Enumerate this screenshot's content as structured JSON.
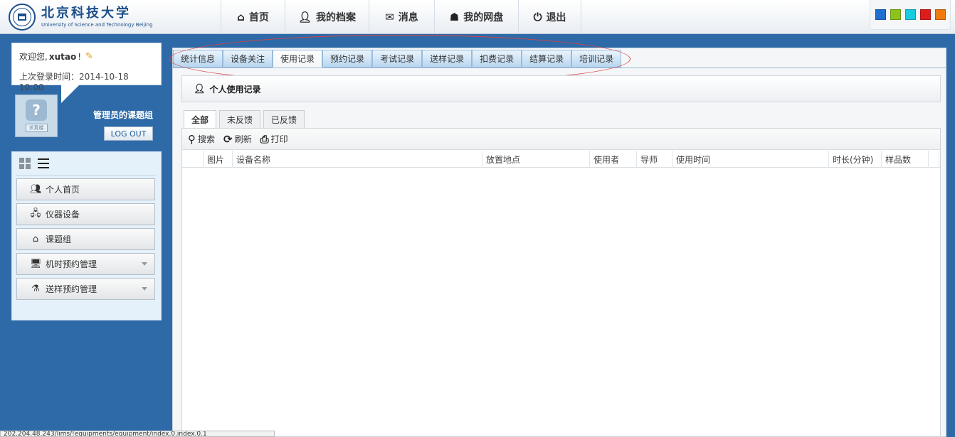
{
  "header": {
    "logo_cn": "北京科技大学",
    "logo_en": "University of Science and Technology Beijing",
    "nav": [
      {
        "label": "首页",
        "icon": "home-icon"
      },
      {
        "label": "我的档案",
        "icon": "user-icon"
      },
      {
        "label": "消息",
        "icon": "envelope-icon"
      },
      {
        "label": "我的网盘",
        "icon": "cloud-drive-icon"
      },
      {
        "label": "退出",
        "icon": "power-icon"
      }
    ],
    "theme_colors": [
      "#1e6fd0",
      "#8cc31a",
      "#17cce0",
      "#e01b1b",
      "#f07a10"
    ]
  },
  "sidebar": {
    "welcome_prefix": "欢迎您,",
    "username": "xutao",
    "welcome_suffix": "!",
    "last_login": "上次登录时间：2014-10-18 10:00",
    "avatar_tag": "求真楼",
    "group_name": "管理员的课题组",
    "logout_label": "LOG OUT",
    "menu": [
      {
        "label": "个人首页",
        "icon": "users-icon",
        "has_caret": false
      },
      {
        "label": "仪器设备",
        "icon": "network-icon",
        "has_caret": false
      },
      {
        "label": "课题组",
        "icon": "house-icon",
        "has_caret": false
      },
      {
        "label": "机时预约管理",
        "icon": "device-user-icon",
        "has_caret": true
      },
      {
        "label": "送样预约管理",
        "icon": "sample-user-icon",
        "has_caret": true
      }
    ]
  },
  "tabs": [
    "统计信息",
    "设备关注",
    "使用记录",
    "预约记录",
    "考试记录",
    "送样记录",
    "扣费记录",
    "结算记录",
    "培训记录"
  ],
  "active_tab": "使用记录",
  "section_title": "个人使用记录",
  "subtabs": [
    "全部",
    "未反馈",
    "已反馈"
  ],
  "active_subtab": "全部",
  "toolbar": {
    "search_label": "搜索",
    "refresh_label": "刷新",
    "print_label": "打印"
  },
  "table": {
    "columns": [
      "",
      "图片",
      "设备名称",
      "放置地点",
      "使用者",
      "导师",
      "使用时间",
      "时长(分钟)",
      "样品数",
      ""
    ]
  },
  "status_url": "202.204.48.243/lims/!equipments/equipment/index.0.index.0.1"
}
